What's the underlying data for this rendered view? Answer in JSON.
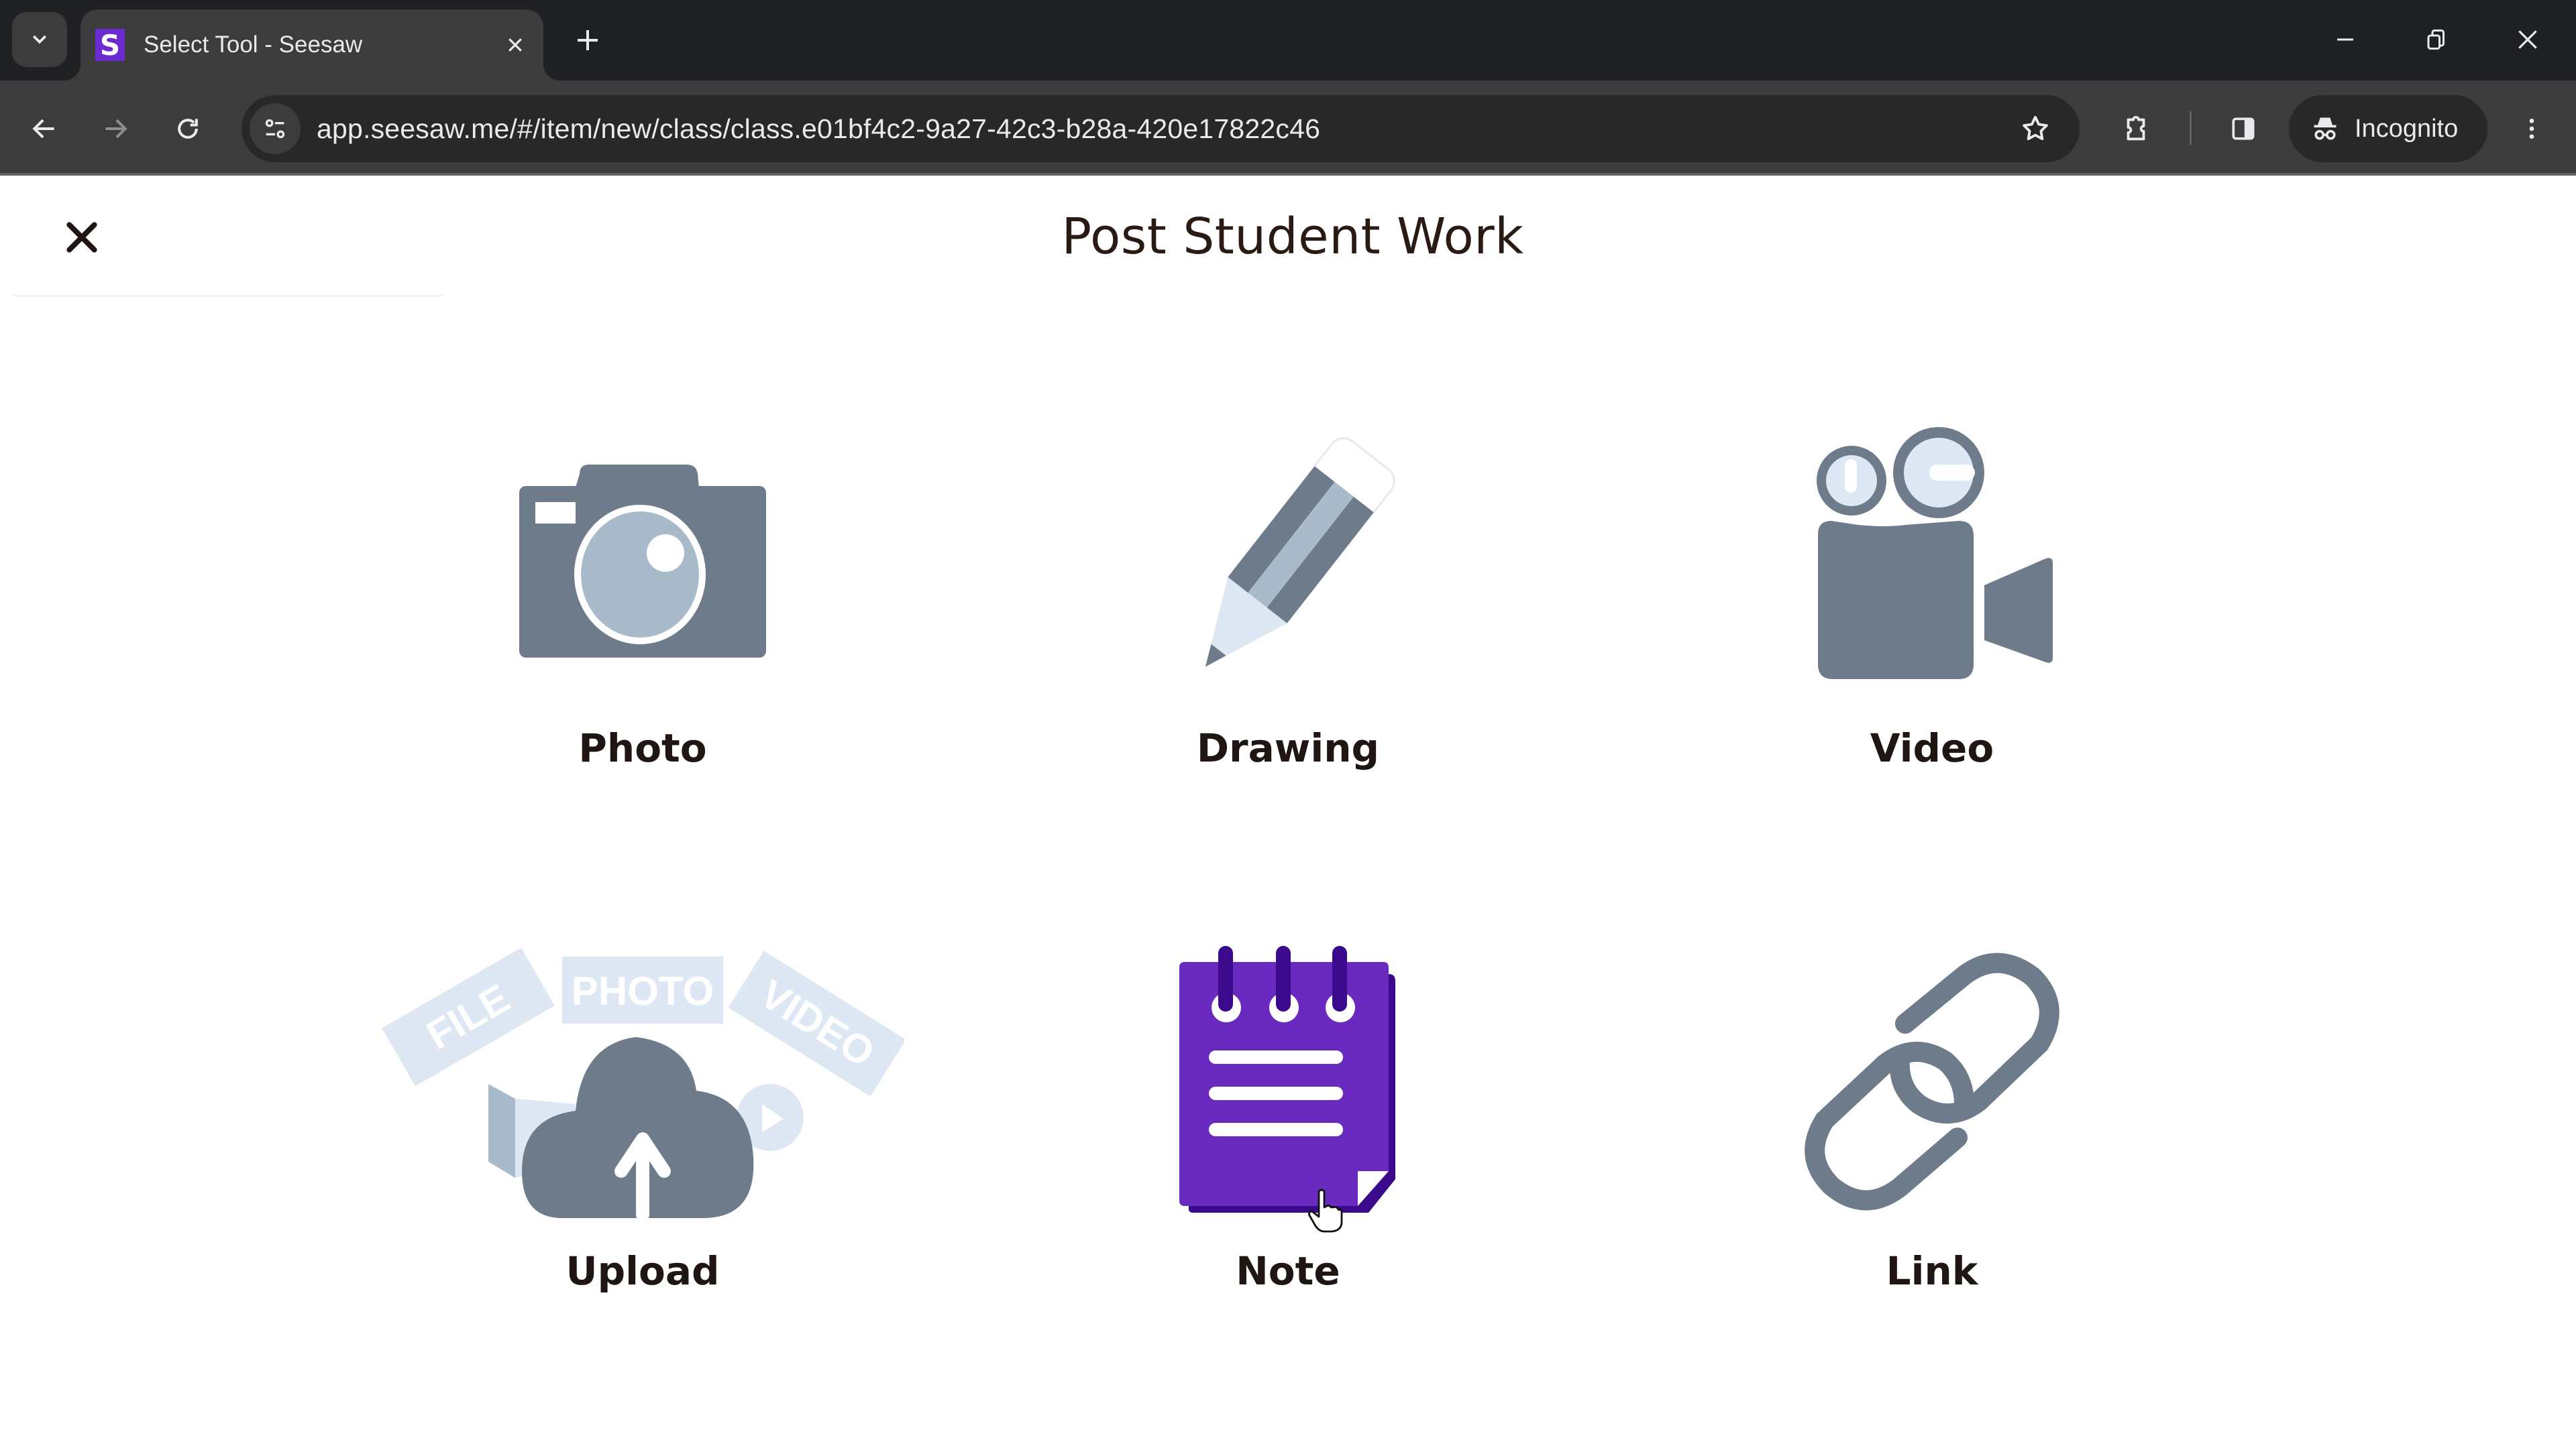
{
  "browser": {
    "tab": {
      "title": "Select Tool - Seesaw",
      "favicon_letter": "S",
      "favicon_color": "#6a2bd0"
    },
    "address_bar": {
      "url": "app.seesaw.me/#/item/new/class/class.e01bf4c2-9a27-42c3-b28a-420e17822c46"
    },
    "profile": {
      "label": "Incognito"
    },
    "icons": {
      "tab_search": "chevron-down-icon",
      "tab_close": "close-icon",
      "new_tab": "plus-icon",
      "back": "arrow-left-icon",
      "forward": "arrow-right-icon",
      "reload": "reload-icon",
      "site_info": "tune-icon",
      "bookmark": "star-icon",
      "extensions": "puzzle-icon",
      "side_panel": "side-panel-icon",
      "incognito": "incognito-icon",
      "menu": "kebab-menu-icon",
      "minimize": "minimize-icon",
      "restore": "restore-icon",
      "close_window": "close-icon"
    }
  },
  "page": {
    "title": "Post Student Work",
    "close_icon": "close-icon",
    "tools": [
      {
        "id": "photo",
        "label": "Photo",
        "icon": "camera-icon"
      },
      {
        "id": "drawing",
        "label": "Drawing",
        "icon": "pencil-icon"
      },
      {
        "id": "video",
        "label": "Video",
        "icon": "video-camera-icon"
      },
      {
        "id": "upload",
        "label": "Upload",
        "icon": "cloud-upload-icon",
        "badges": [
          "FILE",
          "PHOTO",
          "VIDEO"
        ]
      },
      {
        "id": "note",
        "label": "Note",
        "icon": "notepad-icon"
      },
      {
        "id": "link",
        "label": "Link",
        "icon": "link-icon"
      }
    ],
    "colors": {
      "icon_dark": "#6d7b8a",
      "icon_light": "#a9bacb",
      "icon_pale": "#dde8f4",
      "note_purple": "#6a2ac0",
      "note_purple_dark": "#3b0a8c",
      "text": "#1f1512"
    }
  }
}
